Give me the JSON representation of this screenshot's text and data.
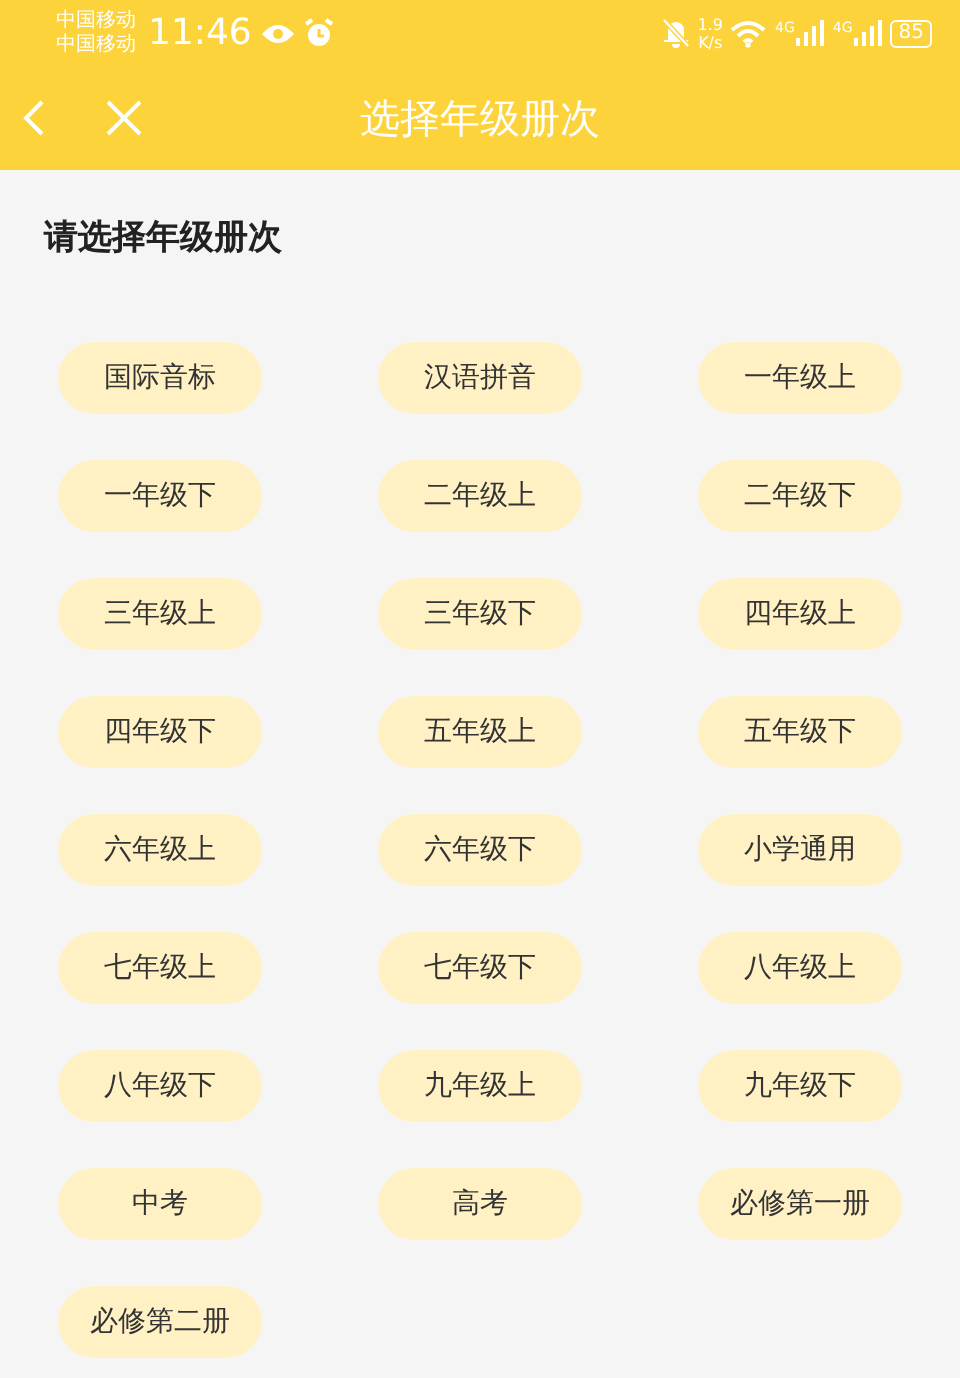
{
  "status_bar": {
    "carriers": [
      "中国移动",
      "中国移动"
    ],
    "time": "11:46",
    "speed_value": "1.9",
    "speed_unit": "K/s",
    "signals": [
      "4G",
      "4G"
    ],
    "battery": "85"
  },
  "header": {
    "title": "选择年级册次"
  },
  "section_title": "请选择年级册次",
  "grades": [
    {
      "label": "国际音标"
    },
    {
      "label": "汉语拼音"
    },
    {
      "label": "一年级上"
    },
    {
      "label": "一年级下"
    },
    {
      "label": "二年级上"
    },
    {
      "label": "二年级下"
    },
    {
      "label": "三年级上"
    },
    {
      "label": "三年级下"
    },
    {
      "label": "四年级上"
    },
    {
      "label": "四年级下"
    },
    {
      "label": "五年级上"
    },
    {
      "label": "五年级下"
    },
    {
      "label": "六年级上"
    },
    {
      "label": "六年级下"
    },
    {
      "label": "小学通用"
    },
    {
      "label": "七年级上"
    },
    {
      "label": "七年级下"
    },
    {
      "label": "八年级上"
    },
    {
      "label": "八年级下"
    },
    {
      "label": "九年级上"
    },
    {
      "label": "九年级下"
    },
    {
      "label": "中考"
    },
    {
      "label": "高考"
    },
    {
      "label": "必修第一册"
    },
    {
      "label": "必修第二册"
    }
  ]
}
